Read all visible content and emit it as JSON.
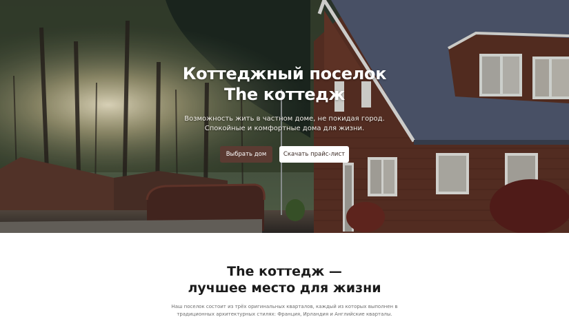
{
  "hero": {
    "title_line1": "Коттеджный поселок",
    "title_line2": "The коттедж",
    "subtitle": "Возможность жить в частном доме, не покидая город. Спокойные и комфортные дома для жизни.",
    "primary_button": "Выбрать дом",
    "secondary_button": "Скачать прайс-лист"
  },
  "about": {
    "title_line1": "The коттедж —",
    "title_line2": "лучшее место для жизни",
    "text": "Наш поселок состоит из трёх оригинальных кварталов, каждый из которых выполнен в традиционных архитектурных стилях: Франция, Ирландия и Английские кварталы. Купить дом в нашем поселке — это начало новой и счастливой жизни в"
  },
  "colors": {
    "primary_button_bg": "#5b3b32",
    "roof": "#55607a",
    "wall": "#6a3b2c"
  }
}
